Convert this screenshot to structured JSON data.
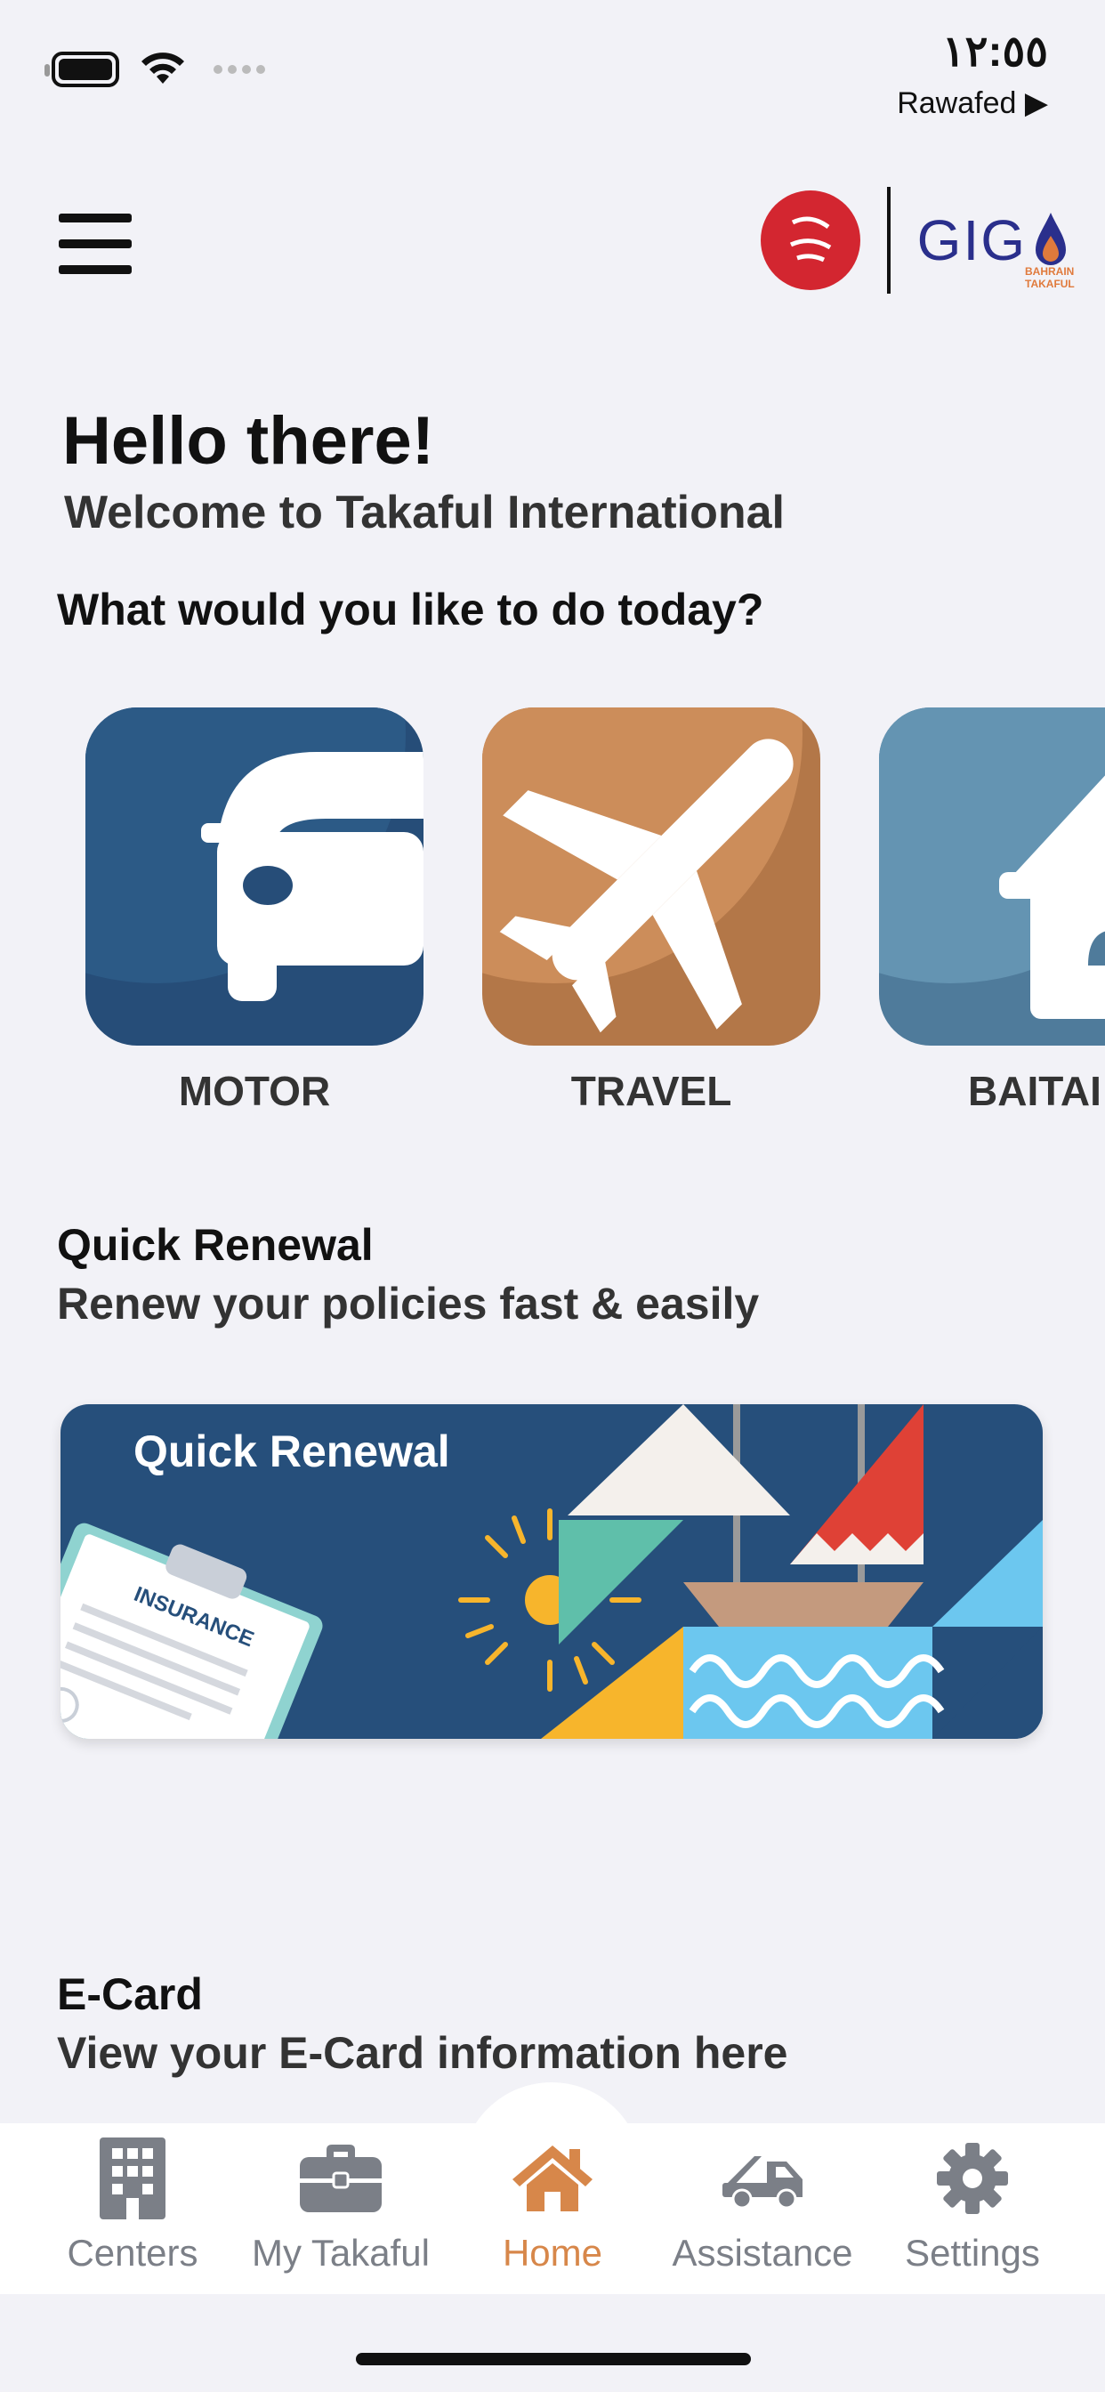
{
  "status_bar": {
    "time": "١٢:٥٥",
    "carrier": "Rawafed ▶",
    "icons": [
      "battery-icon",
      "wifi-icon",
      "signal-icon"
    ]
  },
  "header": {
    "menu_icon": "hamburger-menu-icon",
    "logos": [
      "bahrain-logo",
      "gig-logo"
    ],
    "gig_text": "GIG",
    "gig_sub": "BAHRAIN TAKAFUL"
  },
  "greeting": {
    "title": "Hello there!",
    "subtitle": "Welcome to Takaful International",
    "question": "What would you like to do today?"
  },
  "products": [
    {
      "label": "MOTOR",
      "icon": "car-icon"
    },
    {
      "label": "TRAVEL",
      "icon": "airplane-icon"
    },
    {
      "label": "BAITAI",
      "icon": "house-icon"
    }
  ],
  "quick_renewal": {
    "title": "Quick Renewal",
    "subtitle": "Renew your policies fast & easily",
    "banner_title": "Quick Renewal",
    "banner_doc_text": "INSURANCE"
  },
  "ecard": {
    "title": "E-Card",
    "subtitle": "View your E-Card information here"
  },
  "bottom_nav": [
    {
      "label": "Centers",
      "icon": "building-icon"
    },
    {
      "label": "My Takaful",
      "icon": "briefcase-icon"
    },
    {
      "label": "Home",
      "icon": "home-icon",
      "active": true
    },
    {
      "label": "Assistance",
      "icon": "tow-truck-icon"
    },
    {
      "label": "Settings",
      "icon": "gear-icon"
    }
  ],
  "colors": {
    "accent": "#d7874a",
    "motor": "#264d78",
    "travel": "#b37748",
    "home": "#4f7b9b",
    "nav_inactive": "#7b7f87"
  }
}
